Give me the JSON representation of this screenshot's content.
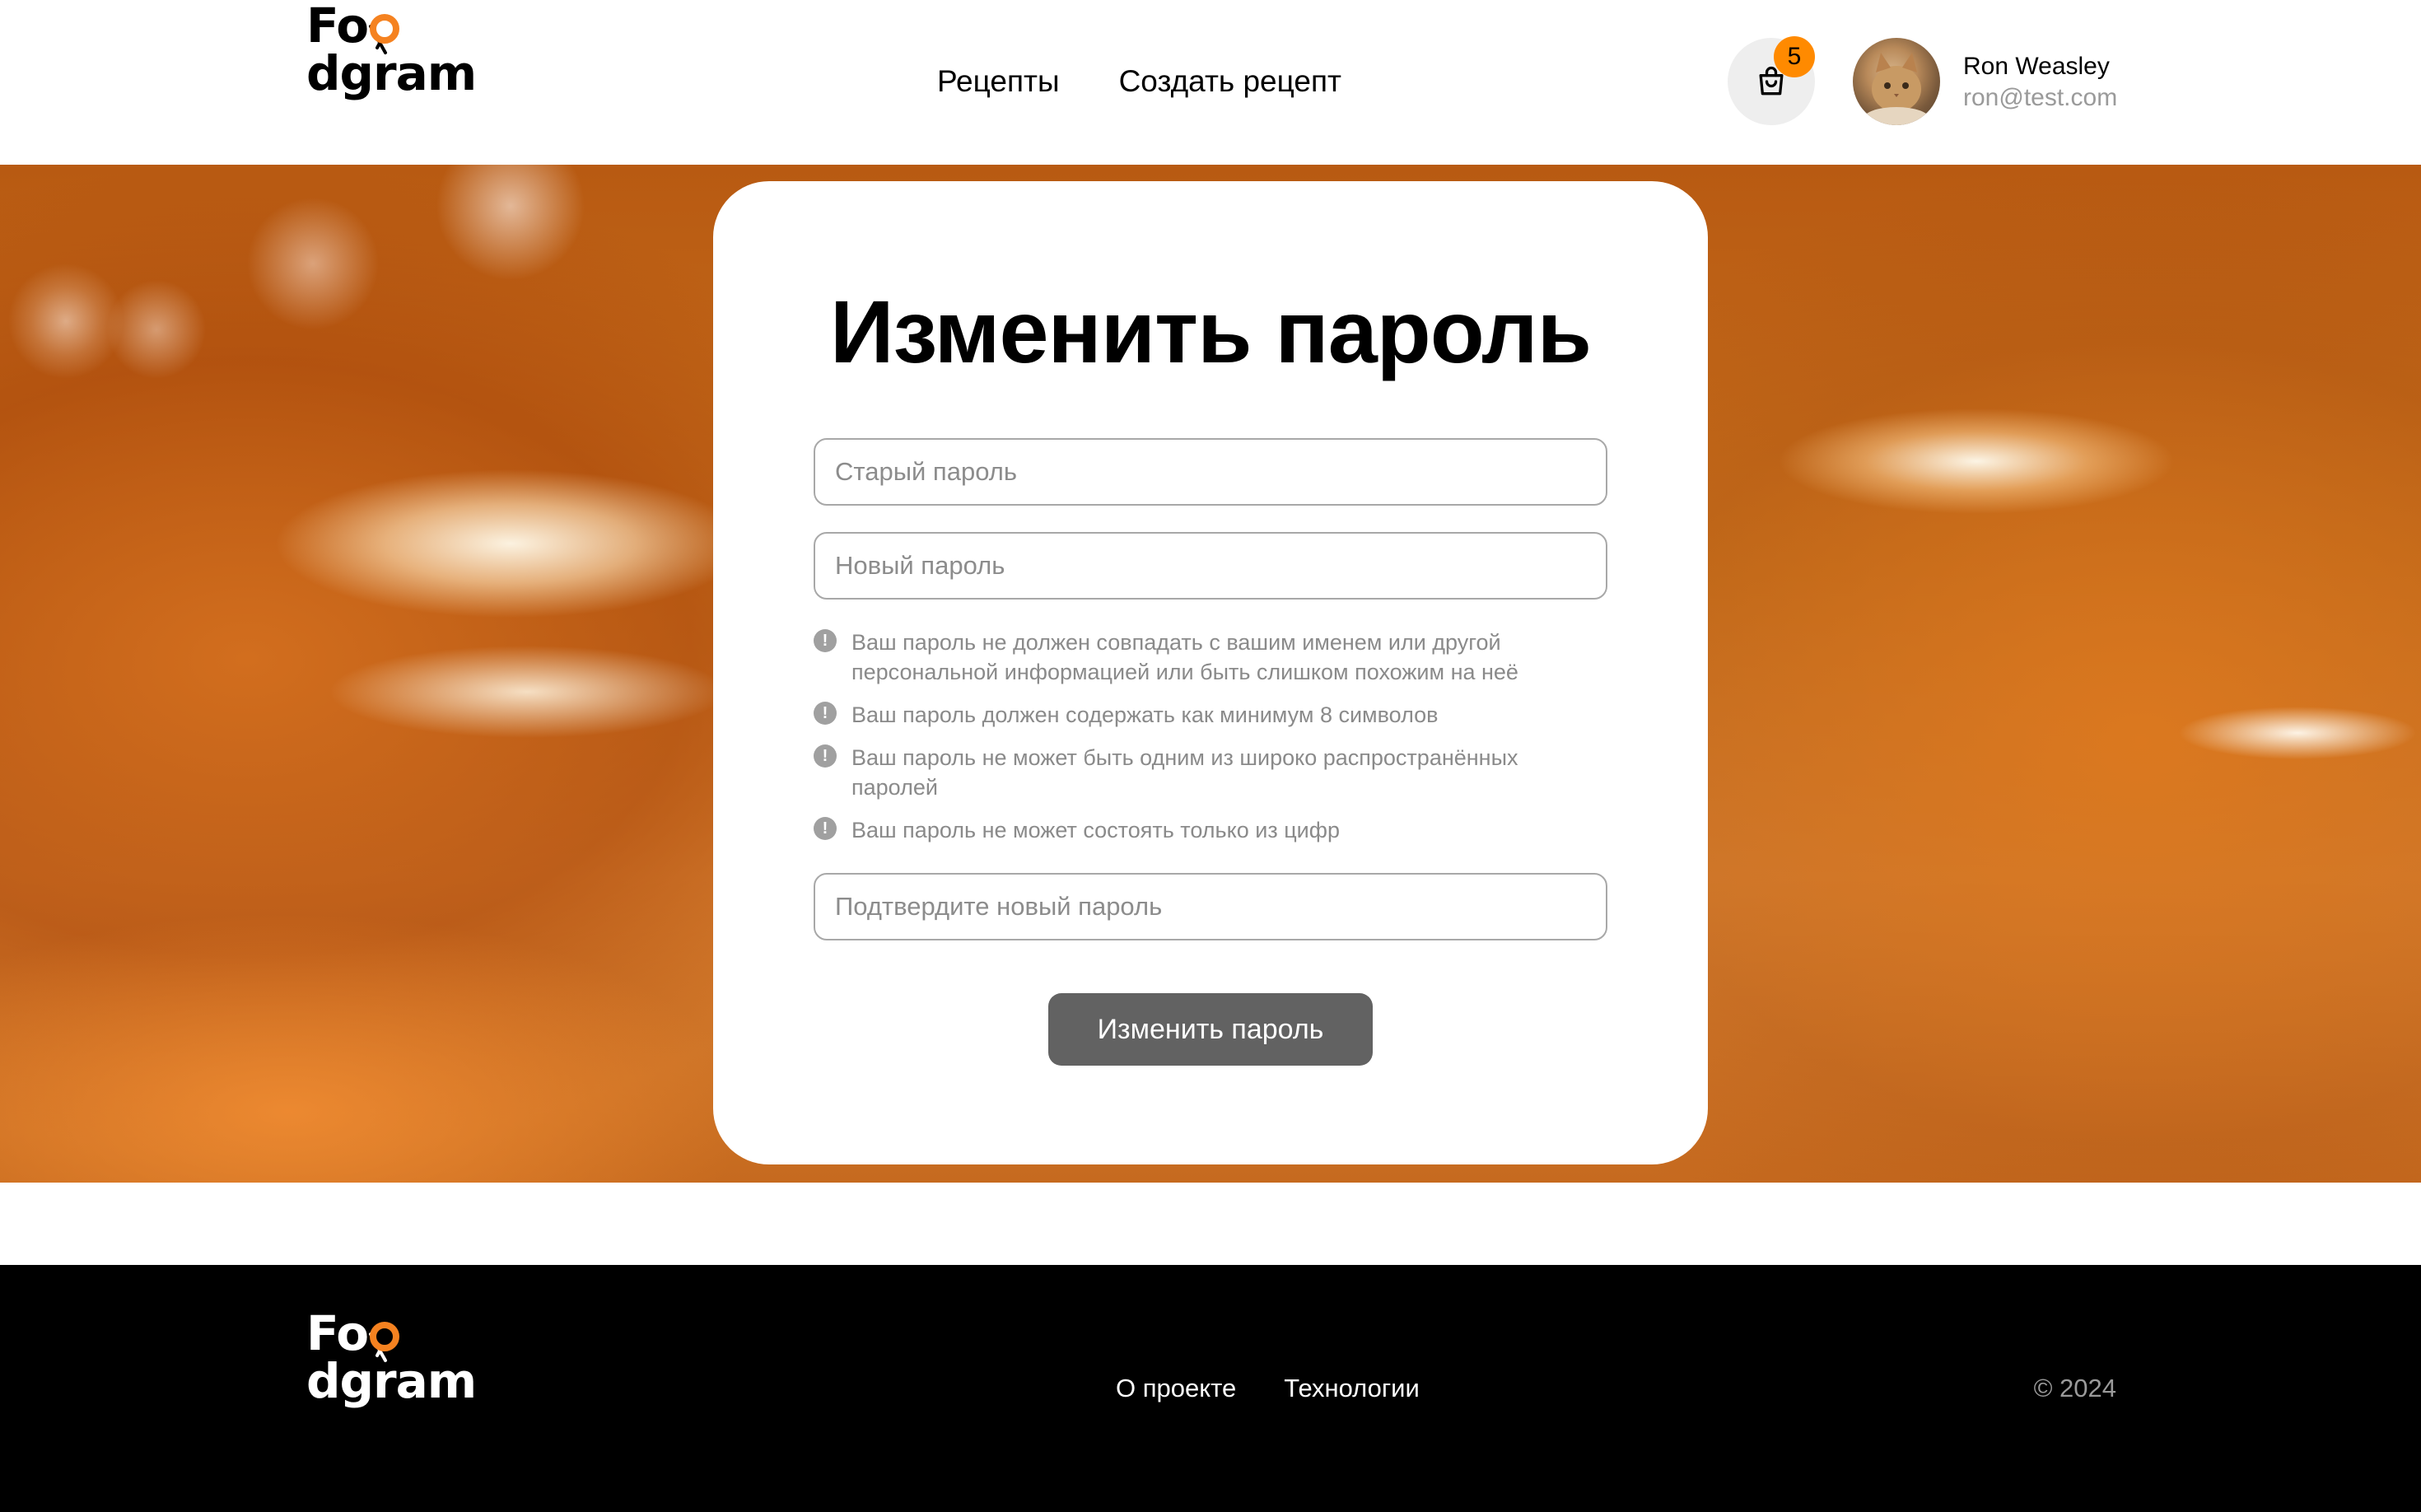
{
  "brand": {
    "logo_text_before": "Fo",
    "logo_text_after": "dgram",
    "accent_color": "#f58220"
  },
  "header": {
    "nav": [
      {
        "label": "Рецепты"
      },
      {
        "label": "Создать рецепт"
      }
    ],
    "cart": {
      "count": "5",
      "icon": "shopping-bag-icon"
    },
    "user": {
      "name": "Ron Weasley",
      "email": "ron@test.com"
    }
  },
  "form": {
    "title": "Изменить пароль",
    "old_password": {
      "placeholder": "Старый пароль"
    },
    "new_password": {
      "placeholder": "Новый пароль"
    },
    "hints": [
      "Ваш пароль не должен совпадать с вашим именем или другой персональной информацией или быть слишком похожим на неё",
      "Ваш пароль должен содержать как минимум 8 символов",
      "Ваш пароль не может быть одним из широко распространённых паролей",
      "Ваш пароль не может состоять только из цифр"
    ],
    "hint_icon": "exclamation-circle-icon",
    "confirm_password": {
      "placeholder": "Подтвердите новый пароль"
    },
    "submit_label": "Изменить пароль"
  },
  "footer": {
    "links": [
      {
        "label": "О проекте"
      },
      {
        "label": "Технологии"
      }
    ],
    "copyright": "© 2024"
  }
}
